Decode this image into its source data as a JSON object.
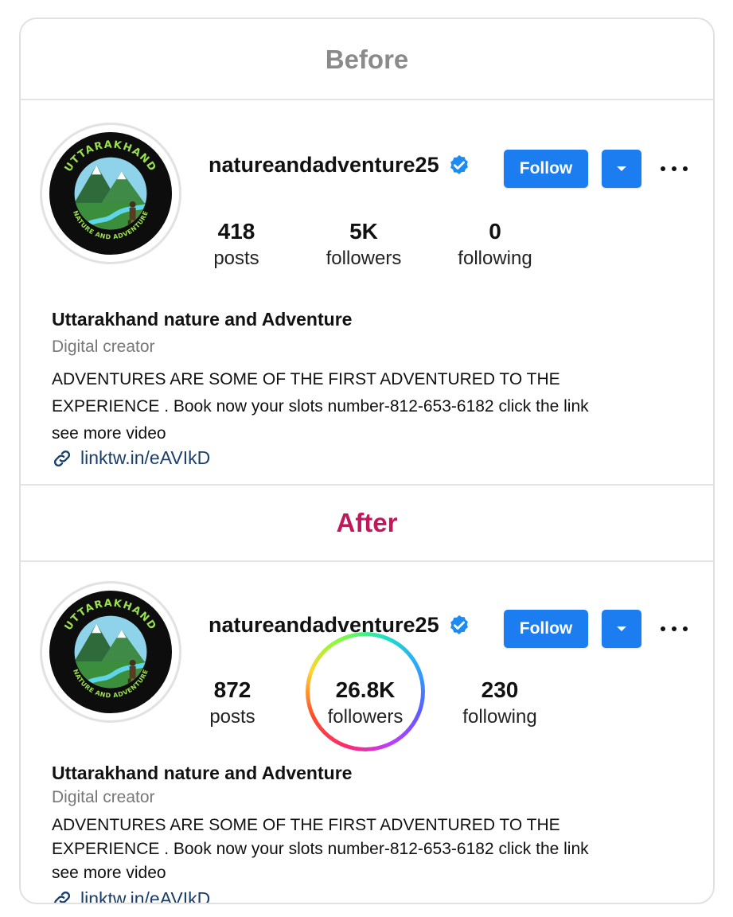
{
  "before": {
    "header": "Before",
    "header_color": "#8a8a8a",
    "username": "natureandadventure25",
    "follow_label": "Follow",
    "stats": {
      "posts": {
        "value": "418",
        "label": "posts"
      },
      "followers": {
        "value": "5K",
        "label": "followers"
      },
      "following": {
        "value": "0",
        "label": "following"
      }
    },
    "full_name": "Uttarakhand nature and Adventure",
    "category": "Digital creator",
    "bio": [
      "ADVENTURES ARE SOME OF THE FIRST ADVENTURED TO THE",
      "EXPERIENCE . Book now your slots number-812-653-6182 click the link",
      "see more video"
    ],
    "link": "linktw.in/eAVIkD"
  },
  "after": {
    "header": "After",
    "header_color": "#c2185b",
    "username": "natureandadventure25",
    "follow_label": "Follow",
    "stats": {
      "posts": {
        "value": "872",
        "label": "posts"
      },
      "followers": {
        "value": "26.8K",
        "label": "followers"
      },
      "following": {
        "value": "230",
        "label": "following"
      }
    },
    "full_name": "Uttarakhand nature and Adventure",
    "category": "Digital creator",
    "bio": [
      "ADVENTURES ARE SOME OF THE FIRST ADVENTURED TO THE",
      "EXPERIENCE . Book now your slots number-812-653-6182 click the link",
      "see more video"
    ],
    "link": "linktw.in/eAVIkD"
  },
  "logo": {
    "top_text": "UTTARAKHAND",
    "bottom_text": "NATURE AND ADVENTURE"
  },
  "colors": {
    "accent": "#1b7df0",
    "verified": "#1d8bf0",
    "link": "#1a3f6b"
  },
  "icons": {
    "verified": "verified-badge-icon",
    "dropdown": "chevron-down-icon",
    "more": "more-options-icon",
    "link": "link-chain-icon"
  }
}
